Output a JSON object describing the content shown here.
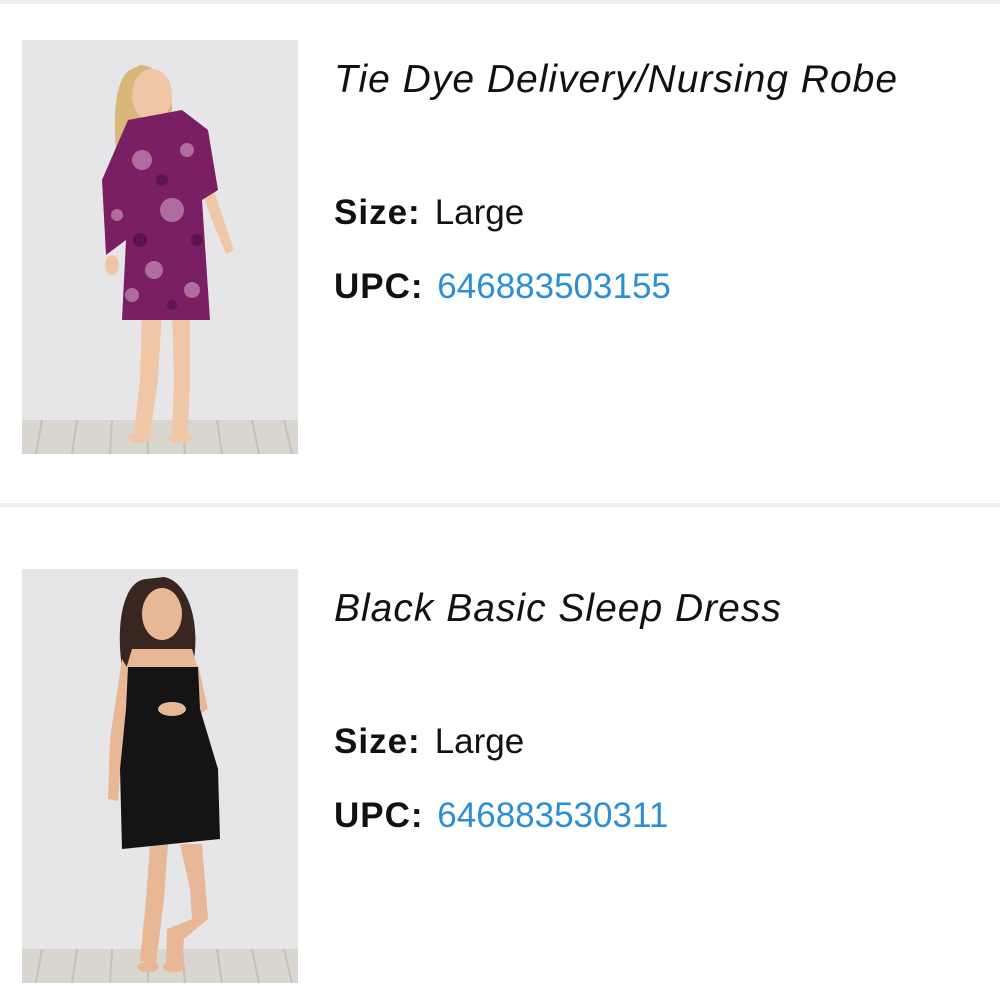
{
  "items": [
    {
      "title": "Tie Dye Delivery/Nursing Robe",
      "size_label": "Size:",
      "size_value": "Large",
      "upc_label": "UPC:",
      "upc_value": "646883503155",
      "garment_color": "#7a1f63"
    },
    {
      "title": "Black Basic Sleep Dress",
      "size_label": "Size:",
      "size_value": "Large",
      "upc_label": "UPC:",
      "upc_value": "646883530311",
      "garment_color": "#141414"
    }
  ],
  "colors": {
    "link": "#2b8fd6",
    "text": "#111111",
    "divider": "#eeeeee"
  }
}
